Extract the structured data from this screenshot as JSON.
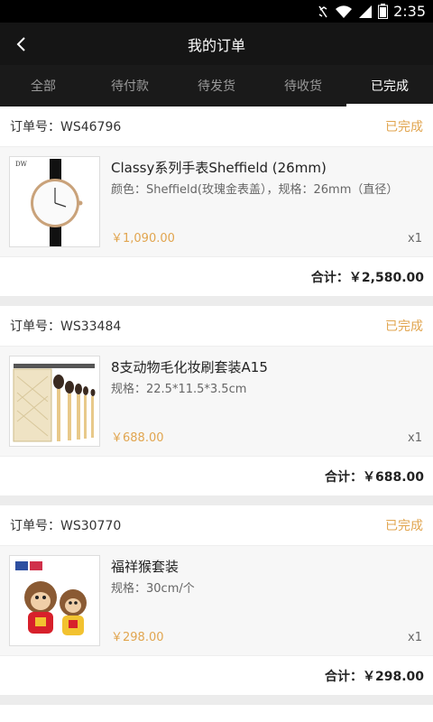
{
  "status_bar": {
    "time": "2:35"
  },
  "header": {
    "title": "我的订单"
  },
  "tabs": [
    {
      "label": "全部"
    },
    {
      "label": "待付款"
    },
    {
      "label": "待发货"
    },
    {
      "label": "待收货"
    },
    {
      "label": "已完成"
    }
  ],
  "orders": [
    {
      "order_no": "订单号：WS46796",
      "status": "已完成",
      "product": {
        "name": "Classy系列手表Sheffield (26mm)",
        "spec": "颜色：Sheffield(玫瑰金表盖），规格：26mm（直径）",
        "price": "￥1,090.00",
        "qty": "x1"
      },
      "total": "合计：￥2,580.00"
    },
    {
      "order_no": "订单号：WS33484",
      "status": "已完成",
      "product": {
        "name": "8支动物毛化妆刷套装A15",
        "spec": "规格：22.5*11.5*3.5cm",
        "price": "￥688.00",
        "qty": "x1"
      },
      "total": "合计：￥688.00"
    },
    {
      "order_no": "订单号：WS30770",
      "status": "已完成",
      "product": {
        "name": "福祥猴套装",
        "spec": "规格：30cm/个",
        "price": "￥298.00",
        "qty": "x1"
      },
      "total": "合计：￥298.00"
    }
  ],
  "colors": {
    "accent": "#e1a54f",
    "header_bg": "#151515",
    "tab_bg": "#1a1a1a"
  }
}
